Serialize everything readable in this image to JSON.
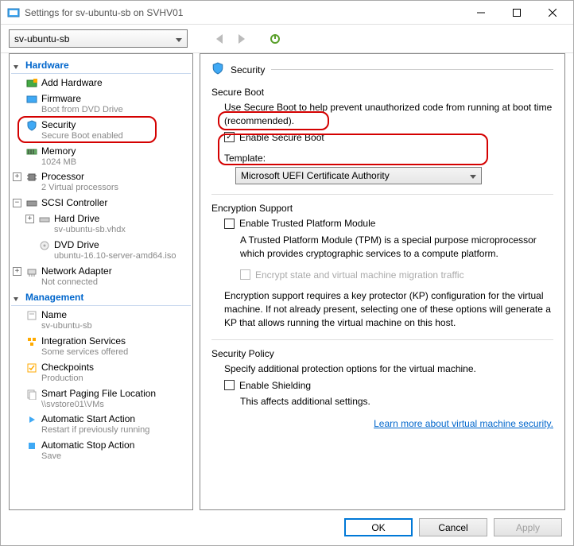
{
  "window": {
    "title": "Settings for sv-ubuntu-sb on SVHV01"
  },
  "vm_dropdown": "sv-ubuntu-sb",
  "sidebar": {
    "hardware_header": "Hardware",
    "management_header": "Management",
    "items": {
      "add_hw": "Add Hardware",
      "firmware": "Firmware",
      "firmware_sub": "Boot from DVD Drive",
      "security": "Security",
      "security_sub": "Secure Boot enabled",
      "memory": "Memory",
      "memory_sub": "1024 MB",
      "processor": "Processor",
      "processor_sub": "2 Virtual processors",
      "scsi": "SCSI Controller",
      "hdd": "Hard Drive",
      "hdd_sub": "sv-ubuntu-sb.vhdx",
      "dvd": "DVD Drive",
      "dvd_sub": "ubuntu-16.10-server-amd64.iso",
      "net": "Network Adapter",
      "net_sub": "Not connected",
      "name": "Name",
      "name_sub": "sv-ubuntu-sb",
      "integ": "Integration Services",
      "integ_sub": "Some services offered",
      "check": "Checkpoints",
      "check_sub": "Production",
      "smart": "Smart Paging File Location",
      "smart_sub": "\\\\svstore01\\VMs",
      "autostart": "Automatic Start Action",
      "autostart_sub": "Restart if previously running",
      "autostop": "Automatic Stop Action",
      "autostop_sub": "Save"
    }
  },
  "panel": {
    "title": "Security",
    "secure_boot": {
      "header": "Secure Boot",
      "desc": "Use Secure Boot to help prevent unauthorized code from running at boot time (recommended).",
      "checkbox": "Enable Secure Boot",
      "template_label": "Template:",
      "template_value": "Microsoft UEFI Certificate Authority"
    },
    "encryption": {
      "header": "Encryption Support",
      "tpm_checkbox": "Enable Trusted Platform Module",
      "tpm_desc": "A Trusted Platform Module (TPM) is a special purpose microprocessor which provides cryptographic services to a compute platform.",
      "encrypt_state": "Encrypt state and virtual machine migration traffic",
      "kp_desc": "Encryption support requires a key protector (KP) configuration for the virtual machine. If not already present, selecting one of these options will generate a KP that allows running the virtual machine on this host."
    },
    "policy": {
      "header": "Security Policy",
      "desc": "Specify additional protection options for the virtual machine.",
      "shield_checkbox": "Enable Shielding",
      "shield_desc": "This affects additional settings."
    },
    "learn_more": "Learn more about virtual machine security."
  },
  "footer": {
    "ok": "OK",
    "cancel": "Cancel",
    "apply": "Apply"
  }
}
